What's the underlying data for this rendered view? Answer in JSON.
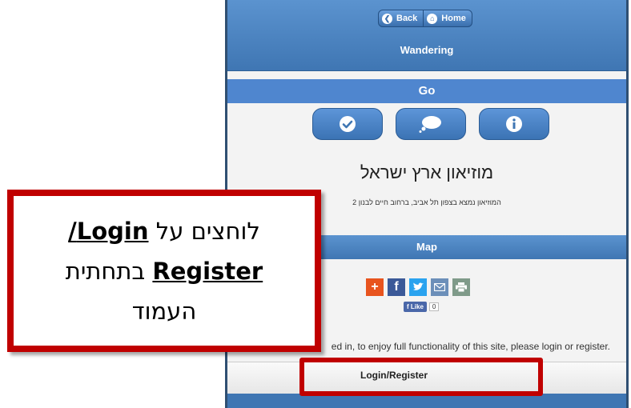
{
  "header": {
    "back_label": "Back",
    "home_label": "Home",
    "title": "Wandering"
  },
  "go_bar": {
    "label": "Go"
  },
  "actions": [
    {
      "icon": "check-icon"
    },
    {
      "icon": "cloud-icon"
    },
    {
      "icon": "info-icon"
    }
  ],
  "place": {
    "name": "מוזיאון ארץ ישראל",
    "description": "המוזיאון נמצא בצפון תל אביב, ברחוב חיים לבנון 2"
  },
  "map_bar": {
    "label": "Map"
  },
  "share": {
    "icons": [
      "plus-icon",
      "facebook-icon",
      "twitter-icon",
      "email-icon",
      "print-icon"
    ],
    "colors": [
      "#e8541e",
      "#3b5998",
      "#2aa3ef",
      "#6c8fb9",
      "#7f9a89"
    ],
    "like_label": "Like",
    "like_count": "0"
  },
  "notice": "ed in, to enjoy full functionality of this site, please login or register.",
  "footer": {
    "login_label": "Login/Register"
  },
  "callout": {
    "line1_prefix": "לוחצים על",
    "line1_link": "Login/",
    "line2_link": "Register",
    "line2_suffix": "בתחתית",
    "line3": "העמוד"
  },
  "colors": {
    "accent": "#4f86cf",
    "highlight": "#c00000"
  }
}
